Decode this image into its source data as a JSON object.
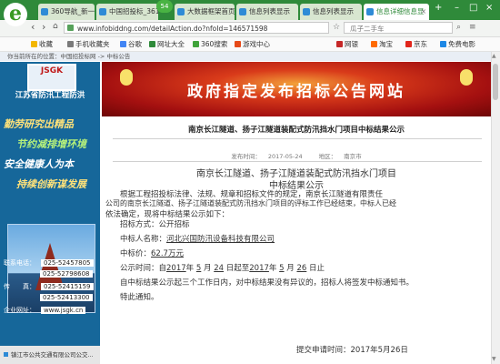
{
  "browser": {
    "tabs": [
      {
        "label": "360导航_新一代"
      },
      {
        "label": "中国招投标_361"
      },
      {
        "label": "大数据框架首页"
      },
      {
        "label": "信息列表显示"
      },
      {
        "label": "信息列表显示"
      },
      {
        "label": "信息详细信息显"
      }
    ],
    "tab_badge": "54",
    "url": "www.infobiddng.com/detailAction.do?nfoId=146571598",
    "search_placeholder": "瓜子二手车",
    "bookmarks": [
      {
        "label": "收藏"
      },
      {
        "label": "手机收藏夹"
      },
      {
        "label": "谷歌"
      },
      {
        "label": "网址大全"
      },
      {
        "label": "360搜索"
      },
      {
        "label": "游戏中心"
      },
      {
        "label": "网银"
      },
      {
        "label": "淘宝"
      },
      {
        "label": "京东"
      },
      {
        "label": "免费电影"
      }
    ]
  },
  "page": {
    "breadcrumb": "你当前所在的位置：中国招投标网 -> 中标公告",
    "sidebar": {
      "logo_text": "JSGK",
      "company_name": "江苏省防汛工程防洪",
      "slogans": [
        "勤劳研究出精品",
        "节约减排增环境",
        "安全健康人为本",
        "持续创新谋发展"
      ],
      "contacts": [
        {
          "label": "联系电话：",
          "value": "025-52457805"
        },
        {
          "label": "",
          "value": "025-52798608"
        },
        {
          "label": "传　　真：",
          "value": "025-52415159"
        },
        {
          "label": "",
          "value": "025-52413300"
        },
        {
          "label": "企业网址：",
          "value": "www.jsgk.cn"
        }
      ],
      "footer": "镇江市公共交通有限公司公交..."
    },
    "banner_title": "政府指定发布招标公告网站",
    "notice_header": "南京长江隧道、扬子江隧道装配式防汛挡水门项目中标结果公示",
    "meta": {
      "date_label": "发布时间：",
      "date": "2017-05-24",
      "region_label": "地区：",
      "region": "南京市"
    },
    "doc_title": [
      "南京长江隧道、扬子江隧道装配式防汛挡水门项目",
      "中标结果公示"
    ],
    "body": {
      "intro_1": "根据工程招投标法律、法规、规章和招标文件的规定，南京长江隧道有限责任",
      "intro_2": "公司的南京长江隧道、扬子江隧道装配式防汛挡水门项目的评标工作已经结束，中标人已经",
      "intro_3": "依法确定，现将中标结果公示如下：",
      "method": "招标方式：公开招标",
      "winner_label": "中标人名称：",
      "winner": "河北兴国防汛设备科技有限公司",
      "price_label": "中标价：",
      "price": "62.7万元",
      "period_prefix": "公示时间：自",
      "y1": "2017",
      "m1": "5",
      "d1": "24",
      "y2": "2017",
      "m2": "5",
      "d2": "26",
      "year_char": "年",
      "month_char": "月",
      "day_from": "日起至",
      "day_end": "日止",
      "note_1": "自中标结果公示起三个工作日内，对中标结果没有异议的，招标人将签发中标通知书。",
      "note_2": "特此通知。",
      "submit": "提交申请时间：2017年5月26日"
    }
  }
}
